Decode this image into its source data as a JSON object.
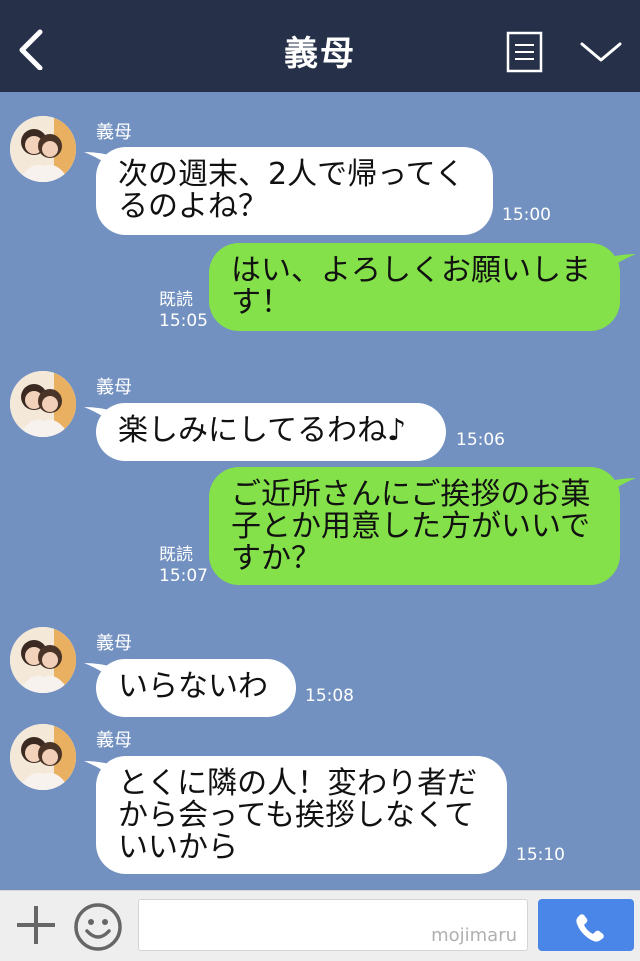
{
  "header": {
    "title": "義母",
    "icons": [
      "chevron-left-icon",
      "memo-icon",
      "chevron-down-icon"
    ]
  },
  "messages": [
    {
      "type": "incoming",
      "sender": "義母",
      "text": "次の週末、2人で帰ってく\nるのよね？",
      "time": "15:00"
    },
    {
      "type": "outgoing",
      "text": "はい、よろしくお願いしま\nす！",
      "read": "既読",
      "time": "15:05"
    },
    {
      "type": "incoming",
      "sender": "義母",
      "text": "楽しみにしてるわね♪",
      "time": "15:06"
    },
    {
      "type": "outgoing",
      "text": "ご近所さんにご挨拶のお菓\n子とか用意した方がいいで\nすか？",
      "read": "既読",
      "time": "15:07"
    },
    {
      "type": "incoming",
      "sender": "義母",
      "text": "いらないわ",
      "time": "15:08"
    },
    {
      "type": "incoming",
      "sender": "義母",
      "text": "とくに隣の人！変わり者だ\nから会っても挨拶しなくて\nいいから",
      "time": "15:10"
    }
  ],
  "input": {
    "watermark": "mojimaru",
    "icons": [
      "plus-icon",
      "smiley-icon",
      "phone-icon"
    ]
  },
  "colors": {
    "header_bg": "#263048",
    "chat_bg": "#7291c0",
    "incoming_bubble": "#ffffff",
    "outgoing_bubble": "#84e14a",
    "call_button": "#4a86e8"
  }
}
